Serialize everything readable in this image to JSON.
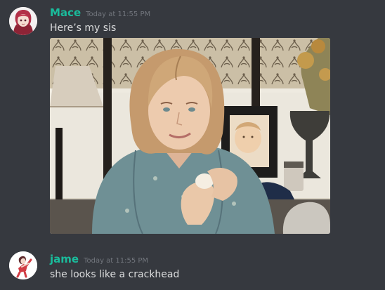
{
  "messages": [
    {
      "author": "Mace",
      "timestamp": "Today at 11:55 PM",
      "text": "Here’s my sis",
      "author_color": "#1abc9c",
      "avatar_icon": "anime-avatar-icon",
      "attachment": {
        "kind": "image",
        "subject": "photo"
      }
    },
    {
      "author": "jame",
      "timestamp": "Today at 11:55 PM",
      "text": "she looks like a crackhead",
      "author_color": "#1abc9c",
      "avatar_icon": "anime-avatar-icon"
    }
  ],
  "colors": {
    "background": "#36393f",
    "message_text": "#dcddde",
    "timestamp_text": "#72767d"
  }
}
